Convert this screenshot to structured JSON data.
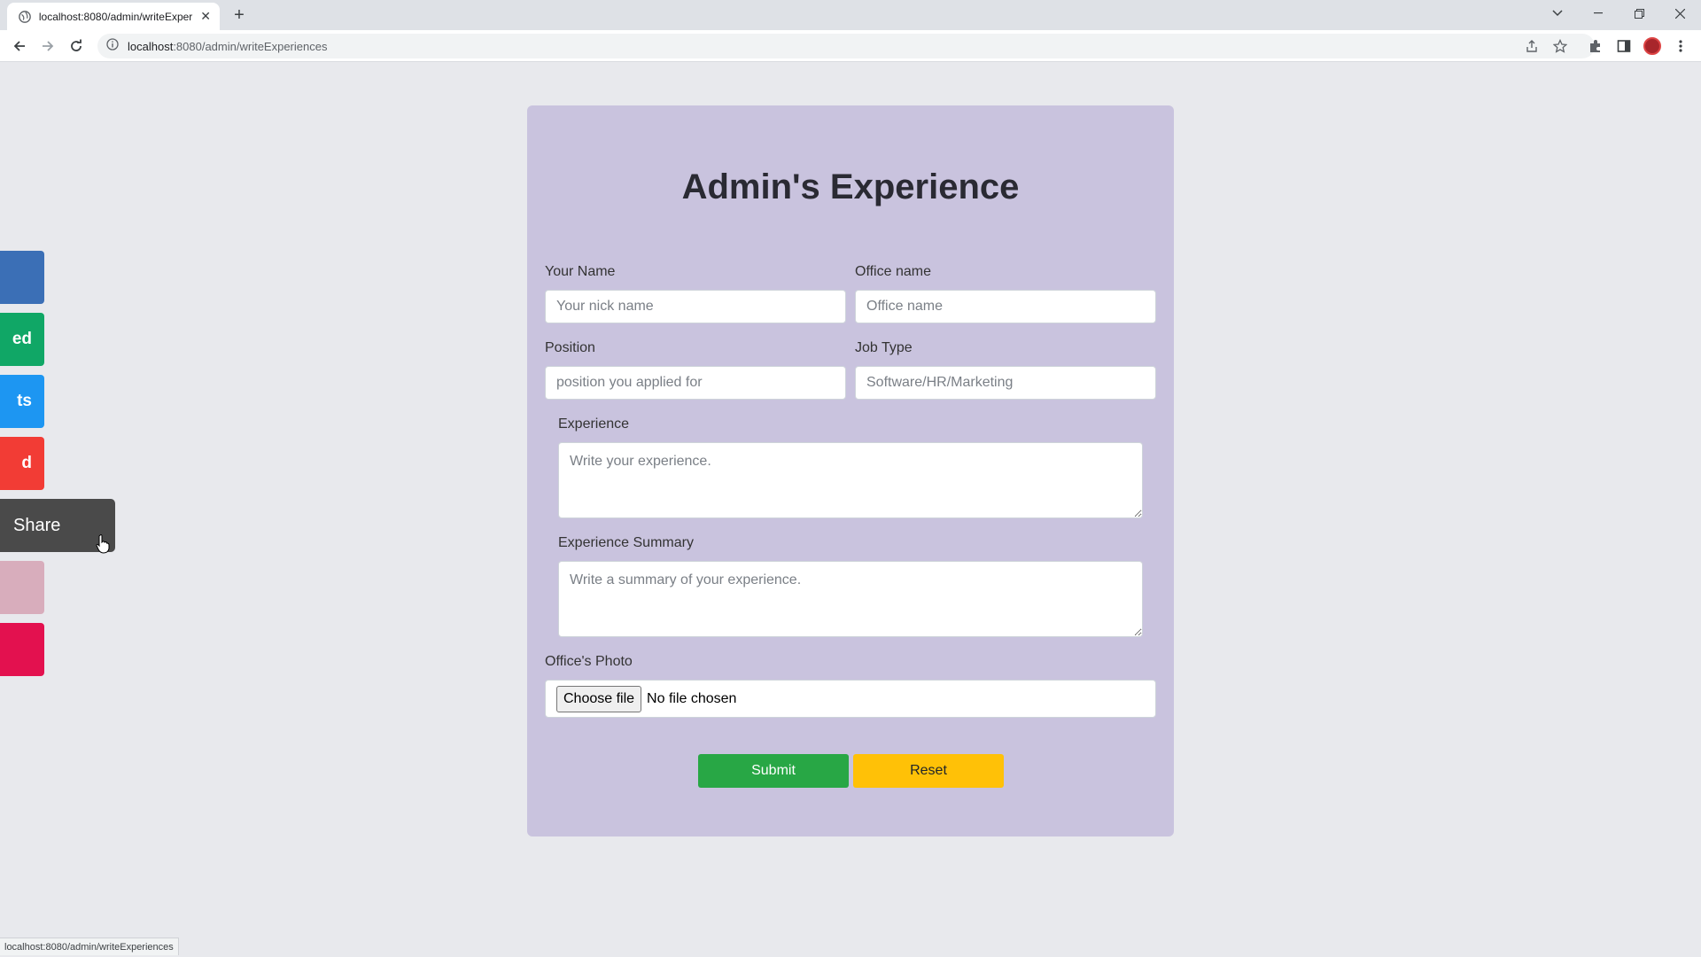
{
  "browser": {
    "tab_title": "localhost:8080/admin/writeExper",
    "url_host": "localhost",
    "url_rest": ":8080/admin/writeExperiences",
    "status_url": "localhost:8080/admin/writeExperiences"
  },
  "sidebar": {
    "buttons": [
      {
        "label": "",
        "color": "#3b6fb6"
      },
      {
        "label": "ed",
        "color": "#10a766"
      },
      {
        "label": "ts",
        "color": "#1d96f2"
      },
      {
        "label": "d",
        "color": "#f23c35"
      },
      {
        "label": "",
        "color": "#d8adbc"
      },
      {
        "label": "",
        "color": "#e3114f"
      }
    ],
    "share_label": "Share"
  },
  "form": {
    "title": "Admin's Experience",
    "name_label": "Your Name",
    "name_placeholder": "Your nick name",
    "office_label": "Office name",
    "office_placeholder": "Office name",
    "position_label": "Position",
    "position_placeholder": "position you applied for",
    "jobtype_label": "Job Type",
    "jobtype_placeholder": "Software/HR/Marketing",
    "experience_label": "Experience",
    "experience_placeholder": "Write your experience.",
    "summary_label": "Experience Summary",
    "summary_placeholder": "Write a summary of your experience.",
    "photo_label": "Office's Photo",
    "choose_file_label": "Choose file",
    "no_file_text": "No file chosen",
    "submit_label": "Submit",
    "reset_label": "Reset"
  }
}
